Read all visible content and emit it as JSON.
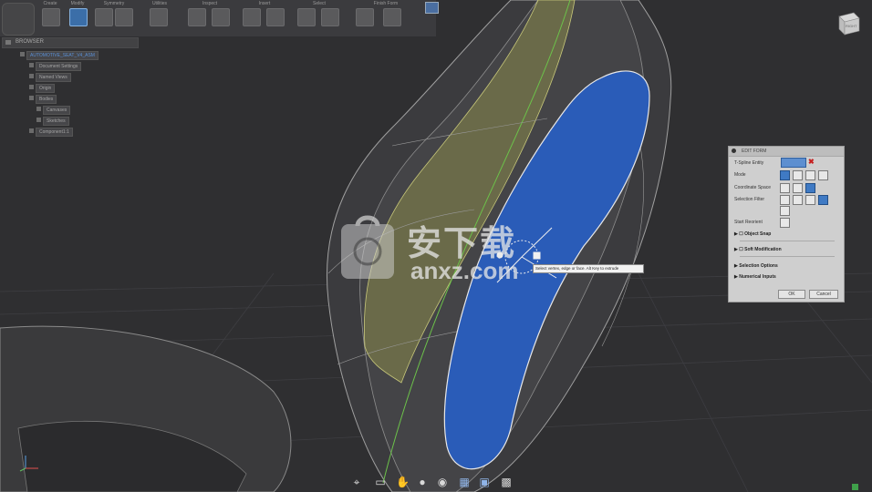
{
  "toolbar": {
    "groups": [
      {
        "label": "Create"
      },
      {
        "label": "Modify"
      },
      {
        "label": "Symmetry"
      },
      {
        "label": "Utilities"
      },
      {
        "label": "Inspect"
      },
      {
        "label": "Insert"
      },
      {
        "label": "Select"
      },
      {
        "label": "Finish Form"
      }
    ]
  },
  "browser": {
    "title": "BROWSER",
    "items": [
      {
        "label": "AUTOMOTIVE_SEAT_V4_ASM"
      },
      {
        "label": "Document Settings"
      },
      {
        "label": "Named Views"
      },
      {
        "label": "Origin"
      },
      {
        "label": "Bodies"
      },
      {
        "label": "Canvases"
      },
      {
        "label": "Sketches"
      },
      {
        "label": "Component1:1"
      }
    ]
  },
  "viewcube": {
    "face_label": "RIGHT"
  },
  "edit_form": {
    "title": "EDIT FORM",
    "rows": {
      "tspline_entity": "T-Spline Entity",
      "mode": "Mode",
      "coordinate_space": "Coordinate Space",
      "selection_filter": "Selection Filter",
      "start_reorient": "Start Reorient"
    },
    "sections": {
      "object_snap": "Object Snap",
      "soft_modification": "Soft Modification",
      "selection_options": "Selection Options",
      "numerical_inputs": "Numerical Inputs"
    },
    "buttons": {
      "ok": "OK",
      "cancel": "Cancel"
    }
  },
  "tooltip": {
    "text": "Select vertex, edge or face. Alt Key to extrude"
  },
  "watermark": {
    "text": "安下载",
    "url": "anxz.com"
  },
  "colors": {
    "background": "#2f2f31",
    "selected_face": "#2a5cb8",
    "side_panel": "#cfcfcf"
  }
}
